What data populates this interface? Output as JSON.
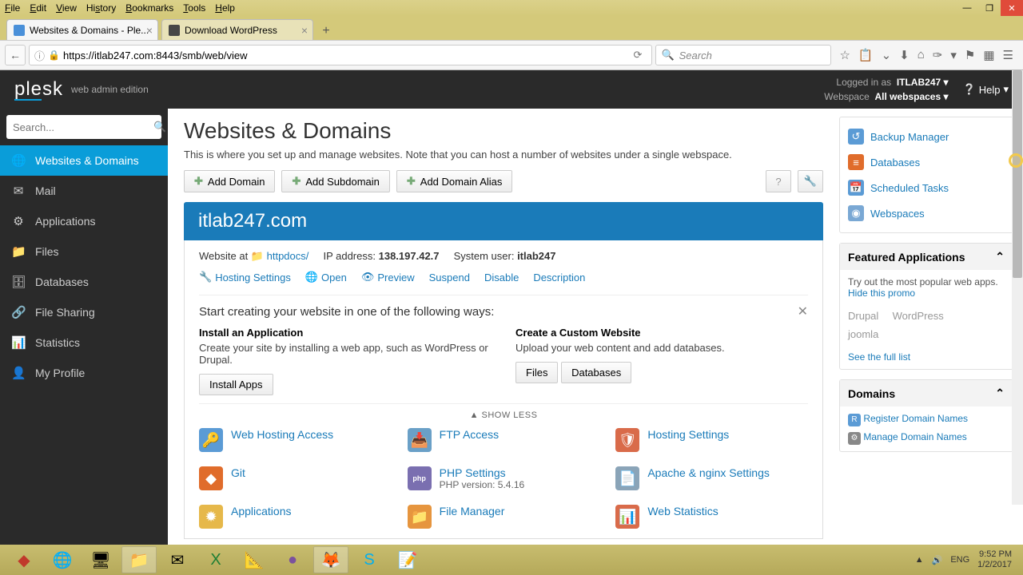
{
  "menubar": [
    "File",
    "Edit",
    "View",
    "History",
    "Bookmarks",
    "Tools",
    "Help"
  ],
  "tabs": [
    {
      "title": "Websites & Domains - Ple...",
      "active": true
    },
    {
      "title": "Download WordPress",
      "active": false
    }
  ],
  "url": "https://itlab247.com:8443/smb/web/view",
  "searchPlaceholder": "Search",
  "plesk": {
    "brand": "plesk",
    "edition": "web admin edition",
    "loggedInLabel": "Logged in as",
    "user": "ITLAB247",
    "webspaceLabel": "Webspace",
    "webspace": "All webspaces",
    "help": "Help"
  },
  "sidebarSearch": "Search...",
  "nav": [
    {
      "label": "Websites & Domains",
      "icon": "🌐",
      "active": true
    },
    {
      "label": "Mail",
      "icon": "✉"
    },
    {
      "label": "Applications",
      "icon": "⚙"
    },
    {
      "label": "Files",
      "icon": "📁"
    },
    {
      "label": "Databases",
      "icon": "🗄"
    },
    {
      "label": "File Sharing",
      "icon": "🔗"
    },
    {
      "label": "Statistics",
      "icon": "📊"
    },
    {
      "label": "My Profile",
      "icon": "👤"
    }
  ],
  "page": {
    "title": "Websites & Domains",
    "desc": "This is where you set up and manage websites. Note that you can host a number of websites under a single webspace.",
    "addDomain": "Add Domain",
    "addSubdomain": "Add Subdomain",
    "addAlias": "Add Domain Alias"
  },
  "domain": {
    "name": "itlab247.com",
    "websiteAt": "Website at",
    "httpdocs": "httpdocs/",
    "ipLabel": "IP address:",
    "ip": "138.197.42.7",
    "sysUserLabel": "System user:",
    "sysUser": "itlab247",
    "links": [
      "Hosting Settings",
      "Open",
      "Preview",
      "Suspend",
      "Disable",
      "Description"
    ]
  },
  "promo": {
    "title": "Start creating your website in one of the following ways:",
    "col1h": "Install an Application",
    "col1p": "Create your site by installing a web app, such as WordPress or Drupal.",
    "col1btn": "Install Apps",
    "col2h": "Create a Custom Website",
    "col2p": "Upload your web content and add databases.",
    "col2btn1": "Files",
    "col2btn2": "Databases"
  },
  "showless": "SHOW LESS",
  "tools": [
    {
      "label": "Web Hosting Access",
      "color": "#5b9bd5",
      "icon": "🔑"
    },
    {
      "label": "FTP Access",
      "color": "#6aa0c7",
      "icon": "📥"
    },
    {
      "label": "Hosting Settings",
      "color": "#d96b4a",
      "icon": "🛡"
    },
    {
      "label": "Git",
      "color": "#e06c2b",
      "icon": "◆"
    },
    {
      "label": "PHP Settings",
      "color": "#7a6fb0",
      "icon": "php",
      "sub": "PHP version: 5.4.16"
    },
    {
      "label": "Apache & nginx Settings",
      "color": "#8aa4b8",
      "icon": "📄"
    },
    {
      "label": "Applications",
      "color": "#e6b84a",
      "icon": "✹"
    },
    {
      "label": "File Manager",
      "color": "#e6953e",
      "icon": "📁"
    },
    {
      "label": "Web Statistics",
      "color": "#d96b4a",
      "icon": "📊"
    }
  ],
  "quicklinks": [
    {
      "label": "Backup Manager",
      "color": "#5b9bd5",
      "icon": "↺"
    },
    {
      "label": "Databases",
      "color": "#e06c2b",
      "icon": "≡"
    },
    {
      "label": "Scheduled Tasks",
      "color": "#5b9bd5",
      "icon": "📅"
    },
    {
      "label": "Webspaces",
      "color": "#7aa8d4",
      "icon": "◉"
    }
  ],
  "featured": {
    "title": "Featured Applications",
    "desc": "Try out the most popular web apps.",
    "hide": "Hide this promo",
    "apps": [
      "Drupal",
      "WordPress",
      "joomla"
    ],
    "seeAll": "See the full list"
  },
  "domainsPanel": {
    "title": "Domains",
    "register": "Register Domain Names",
    "manage": "Manage Domain Names"
  },
  "tray": {
    "lang": "ENG",
    "time": "9:52 PM",
    "date": "1/2/2017"
  }
}
